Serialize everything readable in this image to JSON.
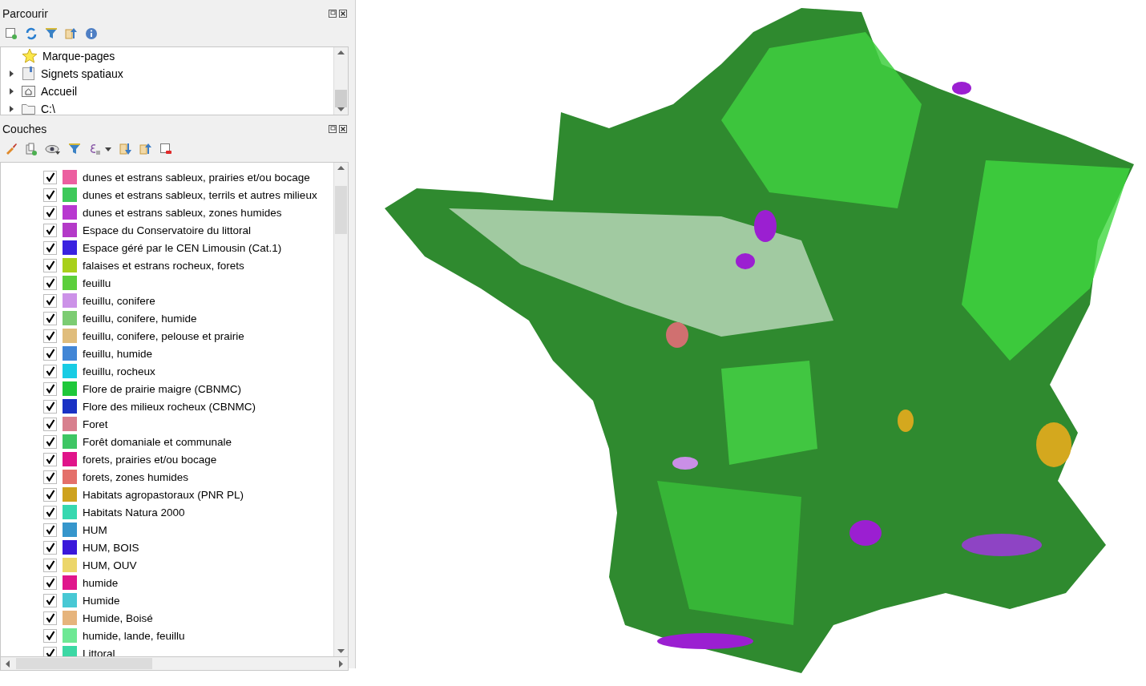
{
  "browser_panel": {
    "title": "Parcourir",
    "items": [
      {
        "kind": "bookmarks",
        "label": "Marque-pages"
      },
      {
        "kind": "spatial",
        "label": "Signets spatiaux"
      },
      {
        "kind": "home",
        "label": "Accueil"
      },
      {
        "kind": "folder",
        "label": "C:\\"
      }
    ]
  },
  "layers_panel": {
    "title": "Couches",
    "layers": [
      {
        "label": "dunes et estrans sableux, prairies et/ou bocage",
        "checked": true,
        "color": "#ec5fa0"
      },
      {
        "label": "dunes et estrans sableux, terrils et autres milieux",
        "checked": true,
        "color": "#3ec95a"
      },
      {
        "label": "dunes et estrans sableux, zones humides",
        "checked": true,
        "color": "#b838d0"
      },
      {
        "label": "Espace du Conservatoire du littoral",
        "checked": true,
        "color": "#b43ac8"
      },
      {
        "label": "Espace géré par le CEN Limousin (Cat.1)",
        "checked": true,
        "color": "#3a22e0"
      },
      {
        "label": "falaises et estrans rocheux, forets",
        "checked": true,
        "color": "#a8d01a"
      },
      {
        "label": "feuillu",
        "checked": true,
        "color": "#5ccf3c"
      },
      {
        "label": "feuillu, conifere",
        "checked": true,
        "color": "#cc92e8"
      },
      {
        "label": "feuillu, conifere, humide",
        "checked": true,
        "color": "#7ccc72"
      },
      {
        "label": "feuillu, conifere, pelouse et prairie",
        "checked": true,
        "color": "#e0bd7c"
      },
      {
        "label": "feuillu, humide",
        "checked": true,
        "color": "#4286d6"
      },
      {
        "label": "feuillu, rocheux",
        "checked": true,
        "color": "#18cce4"
      },
      {
        "label": "Flore de prairie maigre (CBNMC)",
        "checked": true,
        "color": "#1ec83a"
      },
      {
        "label": "Flore des milieux rocheux (CBNMC)",
        "checked": true,
        "color": "#1a32c4"
      },
      {
        "label": "Foret",
        "checked": true,
        "color": "#d8808e"
      },
      {
        "label": "Forêt domaniale et communale",
        "checked": true,
        "color": "#3ec664"
      },
      {
        "label": "forets, prairies et/ou bocage",
        "checked": true,
        "color": "#e0148a"
      },
      {
        "label": "forets, zones humides",
        "checked": true,
        "color": "#e4706a"
      },
      {
        "label": "Habitats agropastoraux (PNR PL)",
        "checked": true,
        "color": "#cea21e"
      },
      {
        "label": "Habitats Natura 2000",
        "checked": true,
        "color": "#36d8b0"
      },
      {
        "label": "HUM",
        "checked": true,
        "color": "#3696cc"
      },
      {
        "label": "HUM, BOIS",
        "checked": true,
        "color": "#3a18da"
      },
      {
        "label": "HUM, OUV",
        "checked": true,
        "color": "#ecd66a"
      },
      {
        "label": "humide",
        "checked": true,
        "color": "#e0168c"
      },
      {
        "label": "Humide",
        "checked": true,
        "color": "#48c8d4"
      },
      {
        "label": "Humide, Boisé",
        "checked": true,
        "color": "#e6b47c"
      },
      {
        "label": "humide, lande, feuillu",
        "checked": true,
        "color": "#6ee894"
      },
      {
        "label": "Littoral",
        "checked": true,
        "color": "#3cd8a4"
      }
    ]
  }
}
